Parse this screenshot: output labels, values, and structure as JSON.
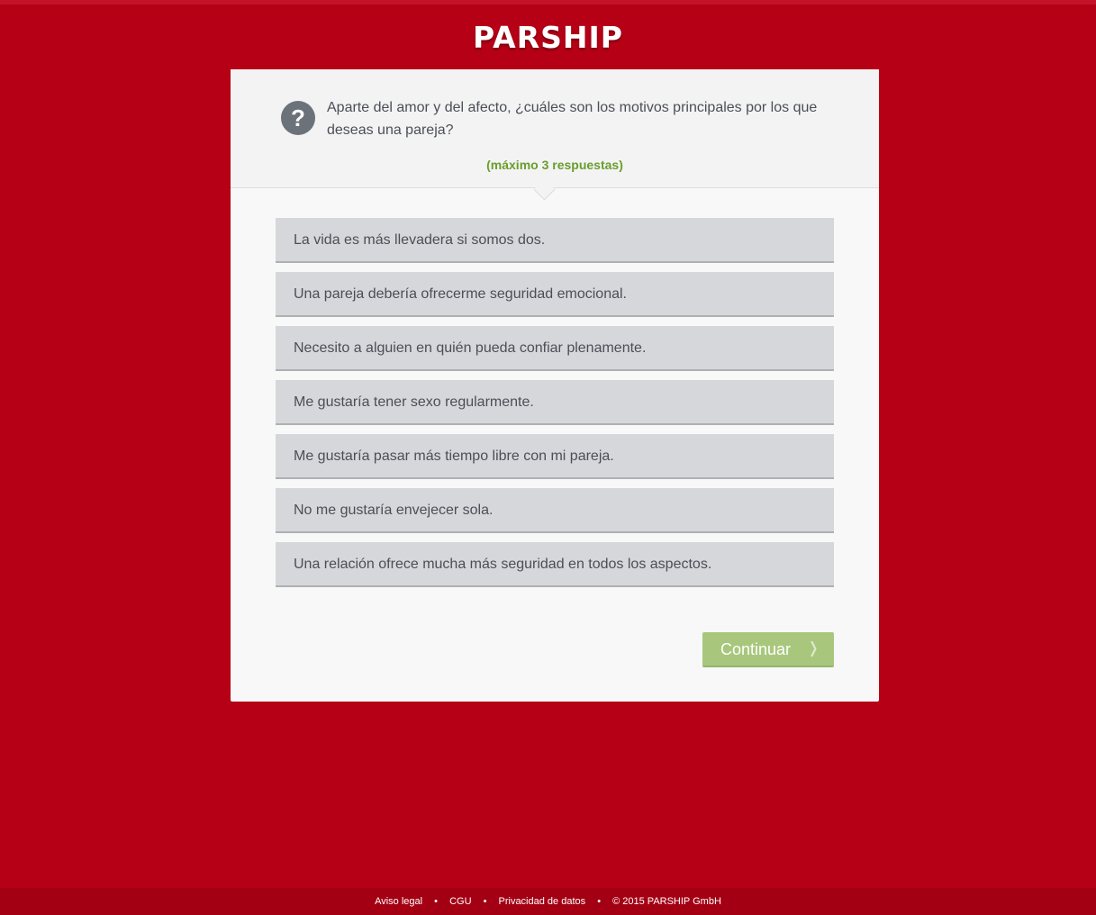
{
  "header": {
    "logo_text": "PARSHIP"
  },
  "question": {
    "icon": "question-icon",
    "text": "Aparte del amor y del afecto, ¿cuáles son los motivos principales por los que deseas una pareja?",
    "hint": "(máximo 3 respuestas)"
  },
  "options": [
    {
      "label": "La vida es más llevadera si somos dos."
    },
    {
      "label": "Una pareja debería ofrecerme seguridad emocional."
    },
    {
      "label": "Necesito a alguien en quién pueda confiar plenamente."
    },
    {
      "label": "Me gustaría tener sexo regularmente."
    },
    {
      "label": "Me gustaría pasar más tiempo libre con mi pareja."
    },
    {
      "label": "No me gustaría envejecer sola."
    },
    {
      "label": "Una relación ofrece mucha más seguridad en todos los aspectos."
    }
  ],
  "actions": {
    "continue_label": "Continuar",
    "continue_icon": "chevron-right-icon",
    "continue_glyph": "❭"
  },
  "footer": {
    "links": [
      "Aviso legal",
      "CGU",
      "Privacidad de datos"
    ],
    "separator": "•",
    "copyright": "© 2015 PARSHIP GmbH"
  },
  "colors": {
    "background": "#b50016",
    "hint_green": "#6a9e2b",
    "button_green": "#a8c77c",
    "option_gray": "#d6d7da"
  }
}
